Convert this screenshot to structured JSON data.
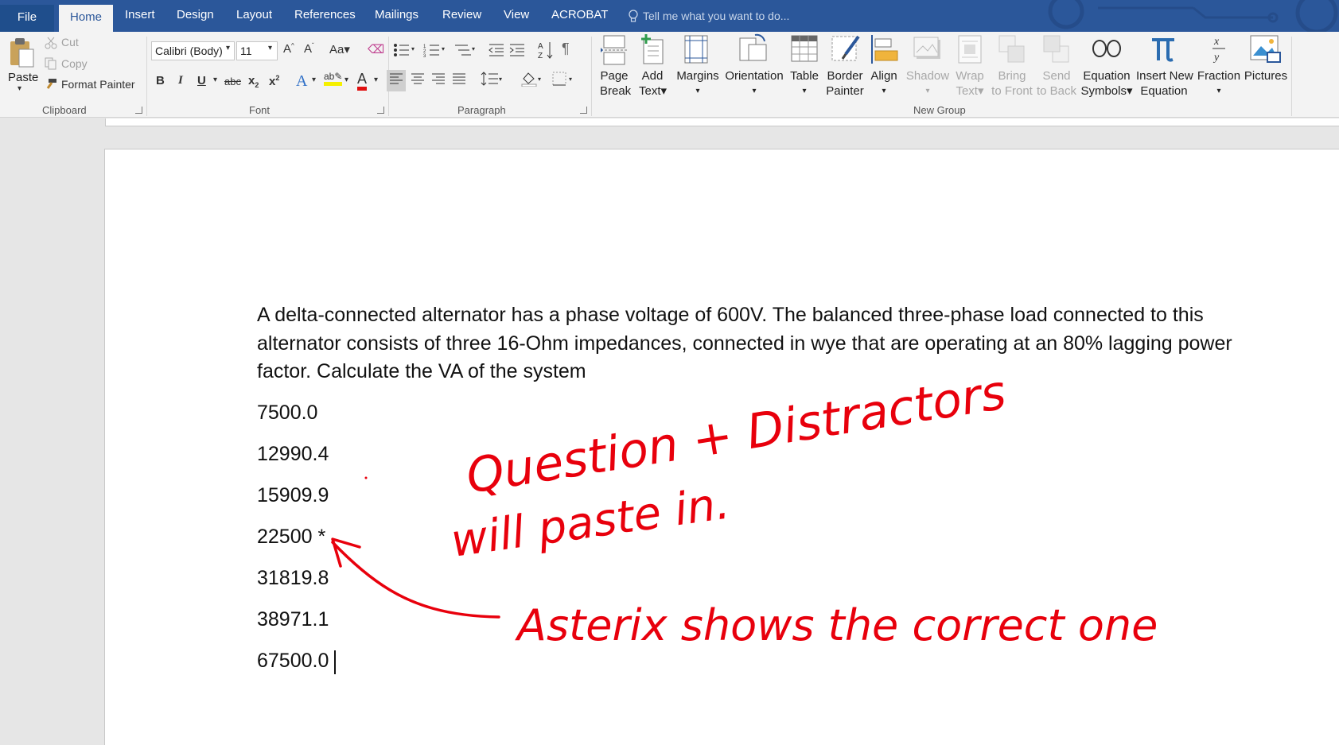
{
  "tabs": [
    "File",
    "Home",
    "Insert",
    "Design",
    "Layout",
    "References",
    "Mailings",
    "Review",
    "View",
    "ACROBAT"
  ],
  "tell_me": "Tell me what you want to do...",
  "clipboard": {
    "paste": "Paste",
    "cut": "Cut",
    "copy": "Copy",
    "format_painter": "Format Painter",
    "group": "Clipboard"
  },
  "font": {
    "name": "Calibri (Body)",
    "size": "11",
    "group": "Font"
  },
  "paragraph": {
    "group": "Paragraph"
  },
  "new_group": {
    "group": "New Group",
    "page_break": [
      "Page",
      "Break"
    ],
    "add_text": [
      "Add",
      "Text"
    ],
    "margins": "Margins",
    "orientation": "Orientation",
    "table": "Table",
    "border_painter": [
      "Border",
      "Painter"
    ],
    "align": "Align",
    "shadow": "Shadow",
    "wrap_text": [
      "Wrap",
      "Text"
    ],
    "bring_to_front": [
      "Bring",
      "to Front"
    ],
    "send_to_back": [
      "Send",
      "to Back"
    ],
    "equation_symbols": [
      "Equation",
      "Symbols"
    ],
    "insert_new_equation": [
      "Insert New",
      "Equation"
    ],
    "fraction": "Fraction",
    "pictures": "Pictures"
  },
  "document": {
    "question": "A delta-connected alternator has a phase voltage of 600V.  The balanced three-phase load connected to this alternator consists of three 16-Ohm impedances, connected in wye that are operating at an 80% lagging power factor.  Calculate the VA of the system",
    "answers": [
      "7500.0",
      "12990.4",
      "15909.9",
      "22500 *",
      "31819.8",
      "38971.1",
      "67500.0"
    ]
  },
  "annotations": {
    "line1": "Question + Distractors",
    "line2": "will paste in.",
    "line3": "Asterix shows the correct one",
    "color": "#e8000c"
  },
  "colors": {
    "ribbon_blue": "#2b579a",
    "ribbon_bg": "#f3f3f3",
    "page_bg": "#e6e6e6"
  }
}
